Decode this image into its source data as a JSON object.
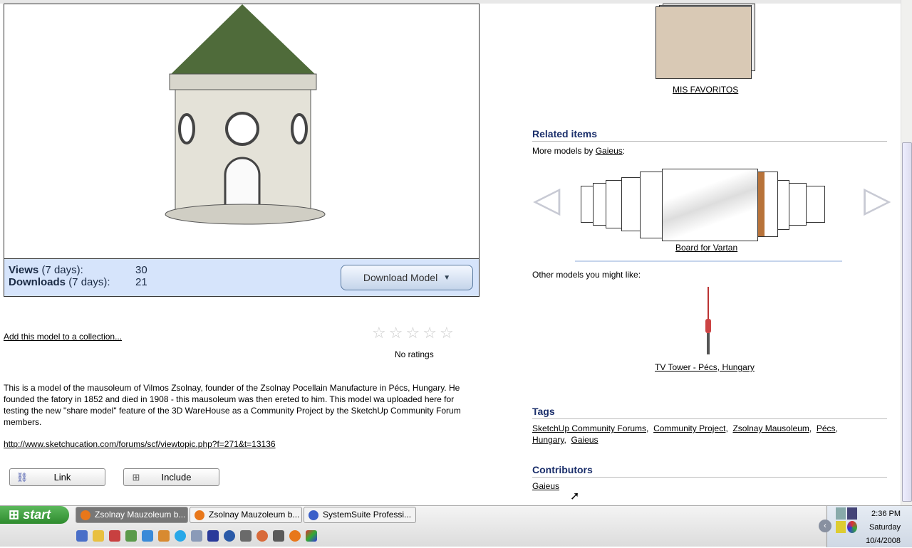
{
  "stats": {
    "views_label": "Views",
    "views_period": "(7 days):",
    "views": "30",
    "downloads_label": "Downloads",
    "downloads_period": "(7 days):",
    "downloads": "21",
    "download_button": "Download Model"
  },
  "collection_link": "Add this model to a collection...",
  "rating": {
    "stars": 0,
    "max": 5,
    "text": "No ratings"
  },
  "description": "This is a model of the mausoleum of Vilmos Zsolnay, founder of the Zsolnay Pocellain Manufacture in Pécs, Hungary. He founded the fatory in 1852 and died in 1908 - this mausoleum was then ereted to him. This model wa uploaded here for testing the new \"share model\" feature of the 3D WareHouse as a Community Project by the SketchUp Community Forum members.",
  "url": "http://www.sketchucation.com/forums/scf/viewtopic.php?f=271&t=13136",
  "buttons": {
    "link": "Link",
    "include": "Include"
  },
  "favorites": {
    "label": "MIS FAVORITOS"
  },
  "related": {
    "title": "Related items",
    "more_by_prefix": "More models by",
    "author": "Gaieus",
    "carousel_selected": "Board for Vartan",
    "other_label": "Other models you might like:",
    "other_item": "TV Tower - Pécs, Hungary"
  },
  "tags": {
    "title": "Tags",
    "items": [
      "SketchUp Community Forums",
      "Community Project",
      "Zsolnay Mausoleum",
      "Pécs",
      "Hungary",
      "Gaieus"
    ]
  },
  "contributors": {
    "title": "Contributors",
    "items": [
      "Gaieus"
    ]
  },
  "taskbar": {
    "start": "start",
    "tasks": [
      "Zsolnay Mauzoleum b...",
      "Zsolnay Mauzoleum b...",
      "SystemSuite Professi..."
    ],
    "time": "2:36 PM",
    "day": "Saturday",
    "date": "10/4/2008"
  }
}
